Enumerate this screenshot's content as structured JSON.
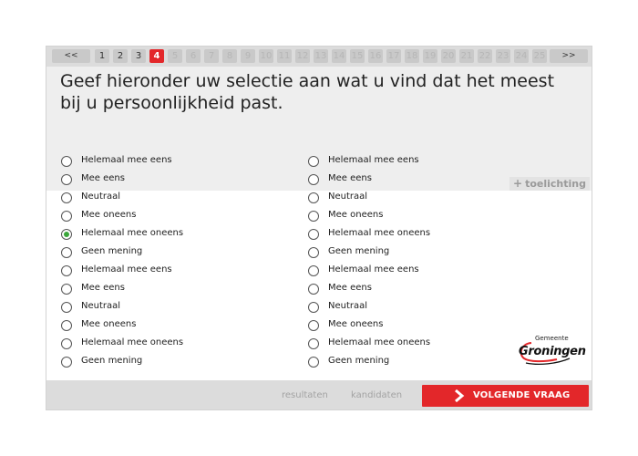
{
  "pager": {
    "prev_label": "<<",
    "next_label": ">>",
    "pages": [
      "1",
      "2",
      "3",
      "4",
      "5",
      "6",
      "7",
      "8",
      "9",
      "10",
      "11",
      "12",
      "13",
      "14",
      "15",
      "16",
      "17",
      "18",
      "19",
      "20",
      "21",
      "22",
      "23",
      "24",
      "25"
    ],
    "current": "4",
    "visited": [
      "1",
      "2",
      "3"
    ]
  },
  "question": {
    "text": "Geef hieronder uw selectie aan wat u vind dat het meest bij u persoonlijkheid past."
  },
  "toelichting_label": "toelichting",
  "options": {
    "left": [
      {
        "label": "Helemaal mee eens",
        "checked": false
      },
      {
        "label": "Mee eens",
        "checked": false
      },
      {
        "label": "Neutraal",
        "checked": false
      },
      {
        "label": "Mee oneens",
        "checked": false
      },
      {
        "label": "Helemaal mee oneens",
        "checked": true
      },
      {
        "label": "Geen mening",
        "checked": false
      },
      {
        "label": "Helemaal mee eens",
        "checked": false
      },
      {
        "label": "Mee eens",
        "checked": false
      },
      {
        "label": "Neutraal",
        "checked": false
      },
      {
        "label": "Mee oneens",
        "checked": false
      },
      {
        "label": "Helemaal mee oneens",
        "checked": false
      },
      {
        "label": "Geen mening",
        "checked": false
      }
    ],
    "right": [
      {
        "label": "Helemaal mee eens",
        "checked": false
      },
      {
        "label": "Mee eens",
        "checked": false
      },
      {
        "label": "Neutraal",
        "checked": false
      },
      {
        "label": "Mee oneens",
        "checked": false
      },
      {
        "label": "Helemaal mee oneens",
        "checked": false
      },
      {
        "label": "Geen mening",
        "checked": false
      },
      {
        "label": "Helemaal mee eens",
        "checked": false
      },
      {
        "label": "Mee eens",
        "checked": false
      },
      {
        "label": "Neutraal",
        "checked": false
      },
      {
        "label": "Mee oneens",
        "checked": false
      },
      {
        "label": "Helemaal mee oneens",
        "checked": false
      },
      {
        "label": "Geen mening",
        "checked": false
      }
    ]
  },
  "logo": {
    "small": "Gemeente",
    "big": "Groningen"
  },
  "footer": {
    "resultaten_label": "resultaten",
    "kandidaten_label": "kandidaten",
    "next_button_label": "VOLGENDE VRAAG"
  },
  "colors": {
    "accent": "#e3272a",
    "selected_radio": "#3aa63a",
    "bar_gray": "#dcdcdc",
    "question_bg": "#eeeeee"
  }
}
